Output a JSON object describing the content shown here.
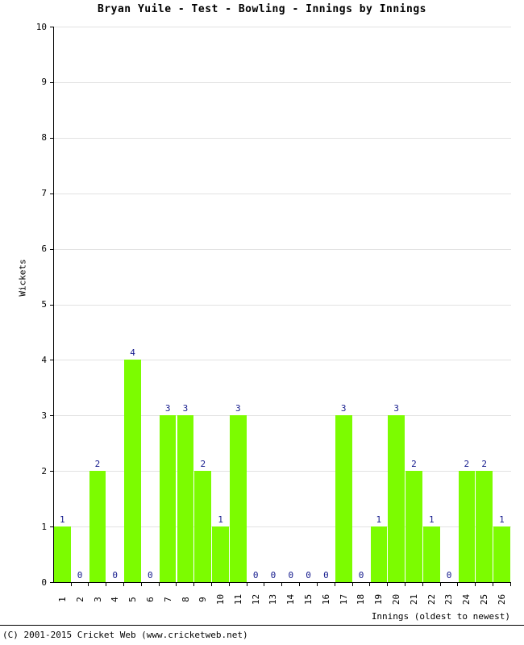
{
  "chart_data": {
    "type": "bar",
    "title": "Bryan Yuile - Test - Bowling - Innings by Innings",
    "xlabel": "Innings (oldest to newest)",
    "ylabel": "Wickets",
    "categories": [
      "1",
      "2",
      "3",
      "4",
      "5",
      "6",
      "7",
      "8",
      "9",
      "10",
      "11",
      "12",
      "13",
      "14",
      "15",
      "16",
      "17",
      "18",
      "19",
      "20",
      "21",
      "22",
      "23",
      "24",
      "25",
      "26"
    ],
    "values": [
      1,
      0,
      2,
      0,
      4,
      0,
      3,
      3,
      2,
      1,
      3,
      0,
      0,
      0,
      0,
      0,
      3,
      0,
      1,
      3,
      2,
      1,
      0,
      2,
      2,
      1
    ],
    "data_labels": [
      "1",
      "0",
      "2",
      "0",
      "4",
      "0",
      "3",
      "3",
      "2",
      "1",
      "3",
      "0",
      "0",
      "0",
      "0",
      "0",
      "3",
      "0",
      "1",
      "3",
      "2",
      "1",
      "0",
      "2",
      "2",
      "1"
    ],
    "ylim": [
      0,
      10
    ],
    "yticks": [
      0,
      1,
      2,
      3,
      4,
      5,
      6,
      7,
      8,
      9,
      10
    ],
    "ytick_labels": [
      "0",
      "1",
      "2",
      "3",
      "4",
      "5",
      "6",
      "7",
      "8",
      "9",
      "10"
    ],
    "grid": true,
    "legend": false,
    "bar_color": "#7CFC00",
    "label_color": "#151b8d",
    "grid_color": "#e2e2e2",
    "axis_color": "#000000"
  },
  "footer": {
    "copyright": "(C) 2001-2015 Cricket Web (www.cricketweb.net)"
  }
}
